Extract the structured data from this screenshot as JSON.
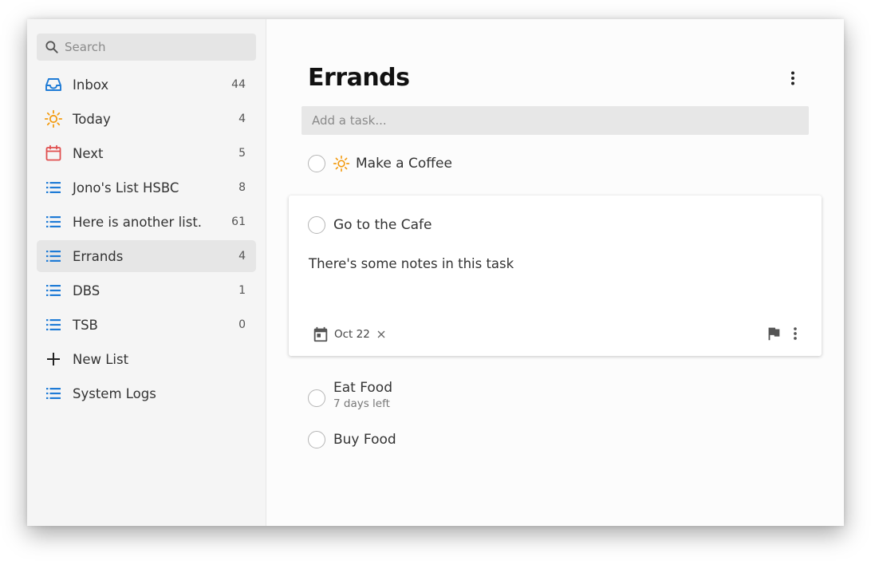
{
  "sidebar": {
    "search": {
      "placeholder": "Search"
    },
    "items": [
      {
        "label": "Inbox",
        "count": "44",
        "icon": "inbox-icon",
        "color": "#1e7bd6"
      },
      {
        "label": "Today",
        "count": "4",
        "icon": "sun-icon",
        "color": "#f39c12"
      },
      {
        "label": "Next",
        "count": "5",
        "icon": "calendar-icon",
        "color": "#e04e4e"
      },
      {
        "label": "Jono's List HSBC",
        "count": "8",
        "icon": "list-icon",
        "color": "#1e7bd6"
      },
      {
        "label": "Here is another list.",
        "count": "61",
        "icon": "list-icon",
        "color": "#1e7bd6"
      },
      {
        "label": "Errands",
        "count": "4",
        "icon": "list-icon",
        "color": "#1e7bd6",
        "active": true
      },
      {
        "label": "DBS",
        "count": "1",
        "icon": "list-icon",
        "color": "#1e7bd6"
      },
      {
        "label": "TSB",
        "count": "0",
        "icon": "list-icon",
        "color": "#1e7bd6"
      },
      {
        "label": "New List",
        "icon": "plus-icon",
        "color": "#222222"
      },
      {
        "label": "System Logs",
        "icon": "list-icon",
        "color": "#1e7bd6"
      }
    ]
  },
  "main": {
    "title": "Errands",
    "add_task": {
      "placeholder": "Add a task..."
    },
    "tasks": [
      {
        "name": "Make a Coffee",
        "today": true
      },
      {
        "name": "Go to the Cafe",
        "expanded": true,
        "notes": "There's some notes in this task",
        "due": "Oct 22"
      },
      {
        "name": "Eat Food",
        "subtext": "7 days left"
      },
      {
        "name": "Buy Food"
      }
    ]
  }
}
